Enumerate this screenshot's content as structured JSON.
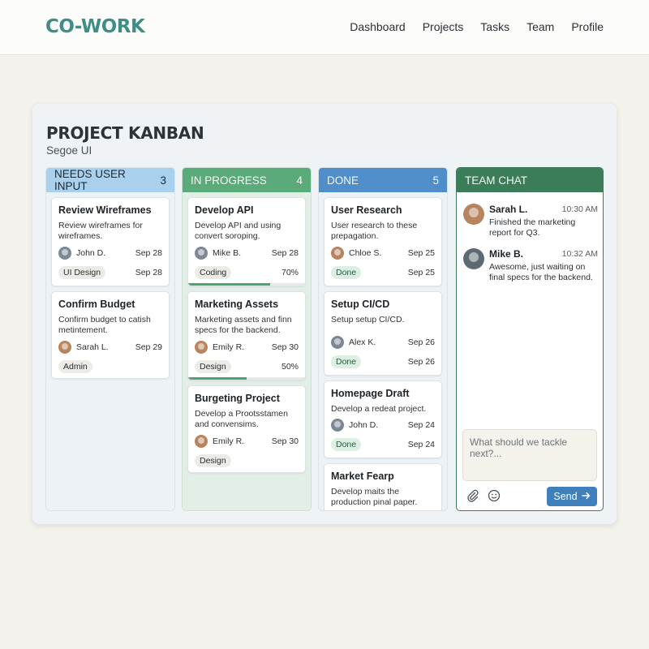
{
  "app": {
    "logo": "CO-WORK",
    "nav": [
      "Dashboard",
      "Projects",
      "Tasks",
      "Team",
      "Profile"
    ]
  },
  "board": {
    "title": "PROJECT KANBAN",
    "subtitle": "Segoe UI",
    "columns": [
      {
        "name": "NEEDS USER INPUT",
        "count": "3",
        "cards": [
          {
            "title": "Review Wireframes",
            "desc": "Review wireframes for wireframes.",
            "assignee": "John D.",
            "date": "Sep 28",
            "tag": "UI Design",
            "tag_date": "Sep 28",
            "avatar": "avatar-male-icon"
          },
          {
            "title": "Confirm Budget",
            "desc": "Confirm budget to catish metintement.",
            "assignee": "Sarah L.",
            "date": "Sep 29",
            "tag": "Admin",
            "avatar": "avatar-female-icon"
          }
        ]
      },
      {
        "name": "IN PROGRESS",
        "count": "4",
        "cards": [
          {
            "title": "Develop API",
            "desc": "Develop API and using convert soroping.",
            "assignee": "Mike B.",
            "date": "Sep 28",
            "tag": "Coding",
            "progress_label": "70%",
            "progress": 0.7,
            "avatar": "avatar-male-icon"
          },
          {
            "title": "Marketing Assets",
            "desc": "Marketing assets and finn specs for the backend.",
            "assignee": "Emily R.",
            "date": "Sep 30",
            "tag": "Design",
            "progress_label": "50%",
            "progress": 0.5,
            "avatar": "avatar-female-icon"
          },
          {
            "title": "Burgeting Project",
            "desc": "Develop a Prootsstamen and convensims.",
            "assignee": "Emily R.",
            "date": "Sep 30",
            "tag": "Design",
            "avatar": "avatar-female-icon"
          }
        ]
      },
      {
        "name": "DONE",
        "count": "5",
        "cards": [
          {
            "title": "User Research",
            "desc": "User research to these prepagation.",
            "assignee": "Chloe S.",
            "date": "Sep 25",
            "tag": "Done",
            "tag_date": "Sep 25",
            "avatar": "avatar-female-icon"
          },
          {
            "title": "Setup CI/CD",
            "desc": "Setup setup CI/CD.",
            "assignee": "Alex K.",
            "date": "Sep 26",
            "tag": "Done",
            "tag_date": "Sep 26",
            "avatar": "avatar-male-icon"
          },
          {
            "title": "Homepage Draft",
            "desc": "Develop a redeat project.",
            "assignee": "John D.",
            "date": "Sep 24",
            "tag": "Done",
            "tag_date": "Sep 24",
            "avatar": "avatar-male-icon"
          },
          {
            "title": "Market Fearp",
            "desc": "Develop maits the production pinal paper."
          }
        ]
      }
    ]
  },
  "chat": {
    "title": "TEAM CHAT",
    "messages": [
      {
        "name": "Sarah L.",
        "time": "10:30 AM",
        "text": "Finished the marketing report for Q3.",
        "avatar": "avatar-female-icon"
      },
      {
        "name": "Mike B.",
        "time": "10:32 AM",
        "text": "Awesome, just waiting on final specs for the backend.",
        "avatar": "avatar-male-icon"
      }
    ],
    "input_placeholder": "What should we tackle next?...",
    "send_label": "Send",
    "send_icon": "arrow-right-icon",
    "tools": [
      "paperclip-icon",
      "smiley-icon"
    ]
  },
  "colors": {
    "logo": "#3f8e86",
    "needs_input": "#a9d1ee",
    "in_progress": "#5aaa7a",
    "done": "#4f8ec9",
    "team_chat": "#3b7d58",
    "send_button": "#3f7fbb"
  }
}
